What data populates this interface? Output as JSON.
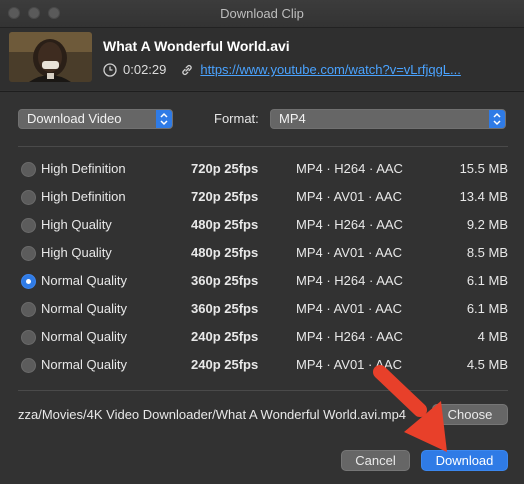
{
  "window": {
    "title": "Download Clip"
  },
  "clip": {
    "title": "What A Wonderful World.avi",
    "duration": "0:02:29",
    "url": "https://www.youtube.com/watch?v=vLrfjqgL..."
  },
  "options": {
    "mode_value": "Download Video",
    "format_label": "Format:",
    "format_value": "MP4"
  },
  "qualities": [
    {
      "quality": "High Definition",
      "resolution": "720p 25fps",
      "codec": "MP4 · H264 · AAC",
      "size": "15.5 MB",
      "selected": false
    },
    {
      "quality": "High Definition",
      "resolution": "720p 25fps",
      "codec": "MP4 · AV01 · AAC",
      "size": "13.4 MB",
      "selected": false
    },
    {
      "quality": "High Quality",
      "resolution": "480p 25fps",
      "codec": "MP4 · H264 · AAC",
      "size": "9.2 MB",
      "selected": false
    },
    {
      "quality": "High Quality",
      "resolution": "480p 25fps",
      "codec": "MP4 · AV01 · AAC",
      "size": "8.5 MB",
      "selected": false
    },
    {
      "quality": "Normal Quality",
      "resolution": "360p 25fps",
      "codec": "MP4 · H264 · AAC",
      "size": "6.1 MB",
      "selected": true
    },
    {
      "quality": "Normal Quality",
      "resolution": "360p 25fps",
      "codec": "MP4 · AV01 · AAC",
      "size": "6.1 MB",
      "selected": false
    },
    {
      "quality": "Normal Quality",
      "resolution": "240p 25fps",
      "codec": "MP4 · H264 · AAC",
      "size": "4 MB",
      "selected": false
    },
    {
      "quality": "Normal Quality",
      "resolution": "240p 25fps",
      "codec": "MP4 · AV01 · AAC",
      "size": "4.5 MB",
      "selected": false
    }
  ],
  "save": {
    "path": "zza/Movies/4K Video Downloader/What A Wonderful World.avi.mp4",
    "choose_label": "Choose"
  },
  "footer": {
    "cancel_label": "Cancel",
    "download_label": "Download"
  },
  "colors": {
    "accent": "#2f7be6",
    "link": "#4aa3ff",
    "annotation_arrow": "#e8402a"
  },
  "icons": [
    "clock-icon",
    "link-icon",
    "chevron-updown-icon"
  ]
}
